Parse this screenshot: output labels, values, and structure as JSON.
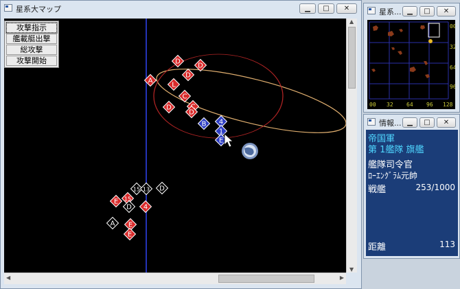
{
  "main_window": {
    "title": "星系大マップ",
    "minimize": "▁",
    "maximize": "□",
    "close": "✕"
  },
  "command_menu": {
    "items": [
      "攻撃指示",
      "艦載艇出撃",
      "総攻撃",
      "攻撃開始"
    ],
    "selected_index": 0
  },
  "minimap_window": {
    "title": "星系...",
    "axis_bottom": [
      "00",
      "32",
      "64",
      "96",
      "128"
    ],
    "axis_right": [
      "00",
      "32",
      "64",
      "96"
    ]
  },
  "info_window": {
    "title": "情報...",
    "faction": "帝国軍",
    "unit": "第 1艦隊 旗艦",
    "role": "艦隊司令官",
    "commander": "ﾛｰｴﾝｸﾞﾗﾑ元帥",
    "ship_label": "戦艦",
    "ship_value": "253/1000",
    "distance_label": "距離",
    "distance_value": "113"
  },
  "map": {
    "colors": {
      "enemy": "#d92b2b",
      "ally": "#2f3fc4",
      "neutral": "#000000",
      "range_circle": "#b02424",
      "orbit": "#e2b070",
      "divider": "#2433b8"
    },
    "upper_red": [
      "D",
      "D",
      "D",
      "A",
      "L",
      "C",
      "C",
      "D",
      "D"
    ],
    "blue": [
      "B",
      "4",
      "1",
      "E"
    ],
    "lower_red": [
      "E",
      "15",
      "4",
      "E",
      "E"
    ],
    "lower_white": [
      "15",
      "13",
      "D",
      "D",
      "A"
    ]
  }
}
